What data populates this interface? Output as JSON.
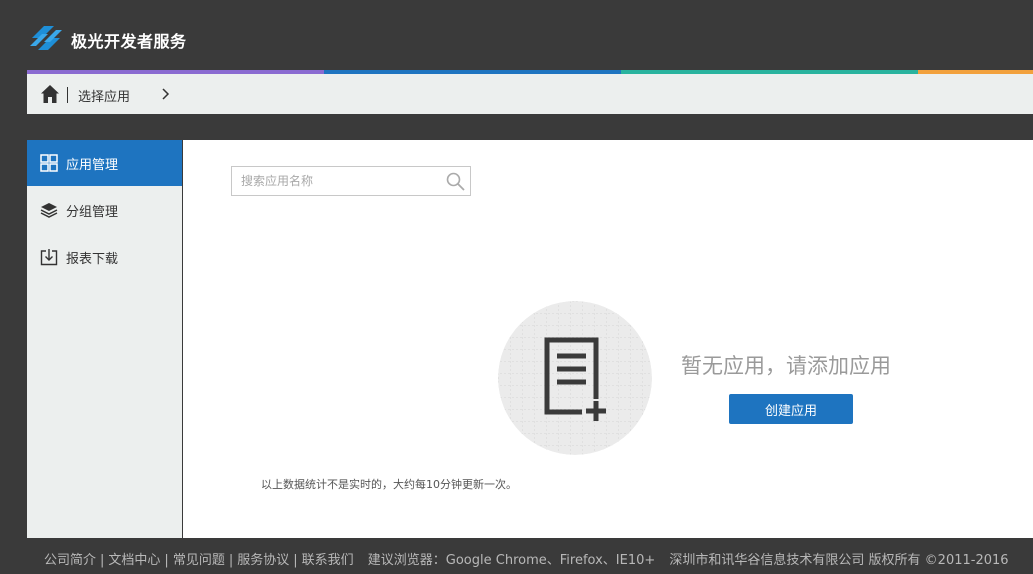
{
  "header": {
    "brand": "极光开发者服务",
    "colors": [
      "#8a6bd1",
      "#1e74c0",
      "#29b39e",
      "#f2a13d"
    ]
  },
  "breadcrumb": {
    "home_icon": "home-icon",
    "current": "选择应用",
    "chevron_icon": "chevron-right-icon"
  },
  "sidebar": {
    "items": [
      {
        "label": "应用管理",
        "icon": "grid-icon",
        "active": true
      },
      {
        "label": "分组管理",
        "icon": "layers-icon",
        "active": false
      },
      {
        "label": "报表下载",
        "icon": "download-icon",
        "active": false
      }
    ]
  },
  "main": {
    "search_placeholder": "搜索应用名称",
    "empty_title": "暂无应用，请添加应用",
    "create_button": "创建应用",
    "note": "以上数据统计不是实时的，大约每10分钟更新一次。"
  },
  "footer": {
    "links": [
      "公司简介",
      "文档中心",
      "常见问题",
      "服务协议",
      "联系我们"
    ],
    "browser_tip": "建议浏览器：Google Chrome、Firefox、IE10+",
    "copyright": "深圳市和讯华谷信息技术有限公司 版权所有 ©2011-2016"
  },
  "theme": {
    "accent": "#1e74c0",
    "dark_bg": "#3a3a3a",
    "panel_bg": "#ecefee"
  }
}
